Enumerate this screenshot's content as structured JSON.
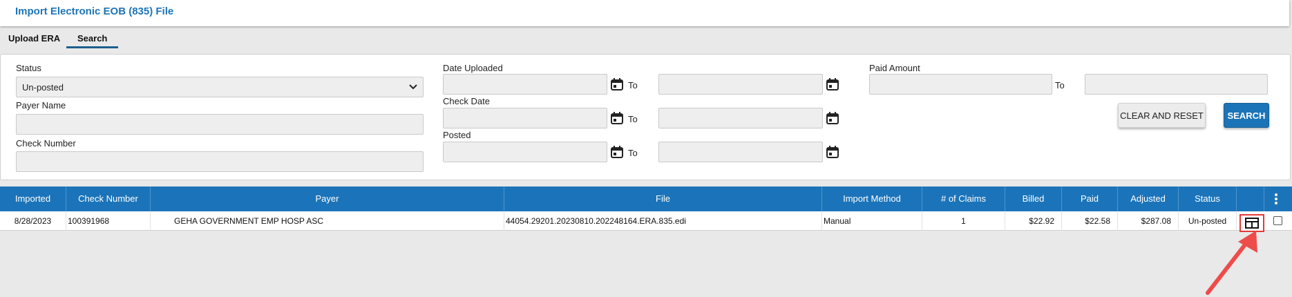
{
  "header": {
    "title": "Import Electronic EOB (835) File"
  },
  "tabs": [
    {
      "label": "Upload ERA"
    },
    {
      "label": "Search",
      "active": true
    }
  ],
  "filters": {
    "status_label": "Status",
    "status_value": "Un-posted",
    "payer_name_label": "Payer Name",
    "payer_name_value": "",
    "check_number_label": "Check Number",
    "check_number_value": "",
    "date_uploaded_label": "Date Uploaded",
    "check_date_label": "Check Date",
    "posted_label": "Posted",
    "paid_amount_label": "Paid Amount",
    "to_label": "To",
    "clear_button": "CLEAR AND RESET",
    "search_button": "SEARCH"
  },
  "table": {
    "columns": [
      "Imported",
      "Check Number",
      "Payer",
      "File",
      "Import Method",
      "# of Claims",
      "Billed",
      "Paid",
      "Adjusted",
      "Status"
    ],
    "rows": [
      {
        "imported": "8/28/2023",
        "check_number": "100391968",
        "payer": "GEHA GOVERNMENT EMP HOSP ASC",
        "file": "44054.29201.20230810.202248164.ERA.835.edi",
        "import_method": "Manual",
        "claims": "1",
        "billed": "$22.92",
        "paid": "$22.58",
        "adjusted": "$287.08",
        "status": "Un-posted"
      }
    ]
  },
  "icons": {
    "calendar": "calendar-icon",
    "kebab": "more-vert-icon",
    "view": "table-view-icon",
    "chevron": "chevron-down-icon"
  },
  "colors": {
    "accent": "#1c74b8",
    "header_bar": "#1b74b9",
    "highlight": "#e53935"
  }
}
